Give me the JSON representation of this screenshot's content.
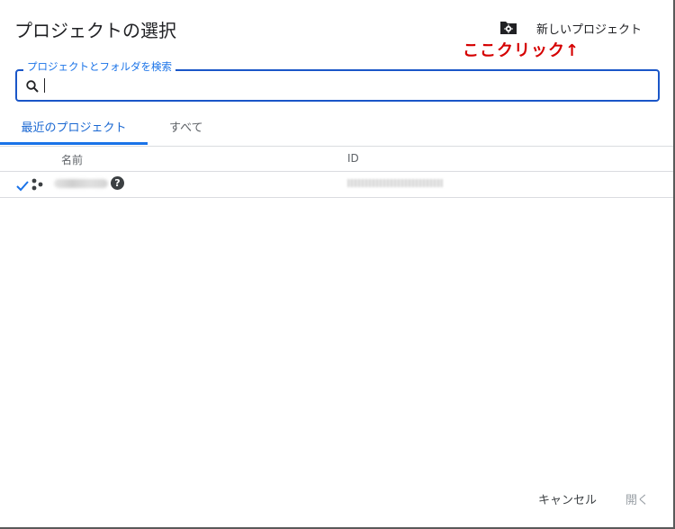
{
  "dialog": {
    "title": "プロジェクトの選択",
    "new_project_label": "新しいプロジェクト",
    "new_project_icon": "folder-gear-icon",
    "annotation": "ここクリック↑"
  },
  "search": {
    "label": "プロジェクトとフォルダを検索",
    "value": "",
    "icon": "search-icon"
  },
  "tabs": [
    {
      "label": "最近のプロジェクト",
      "active": true
    },
    {
      "label": "すべて",
      "active": false
    }
  ],
  "table": {
    "columns": [
      "名前",
      "ID"
    ],
    "rows": [
      {
        "selected": true,
        "name": "",
        "id": ""
      }
    ]
  },
  "footer": {
    "cancel_label": "キャンセル",
    "open_label": "開く"
  },
  "colors": {
    "accent": "#1a73e8",
    "annotation": "#d50000",
    "disabled": "#9aa0a6"
  }
}
